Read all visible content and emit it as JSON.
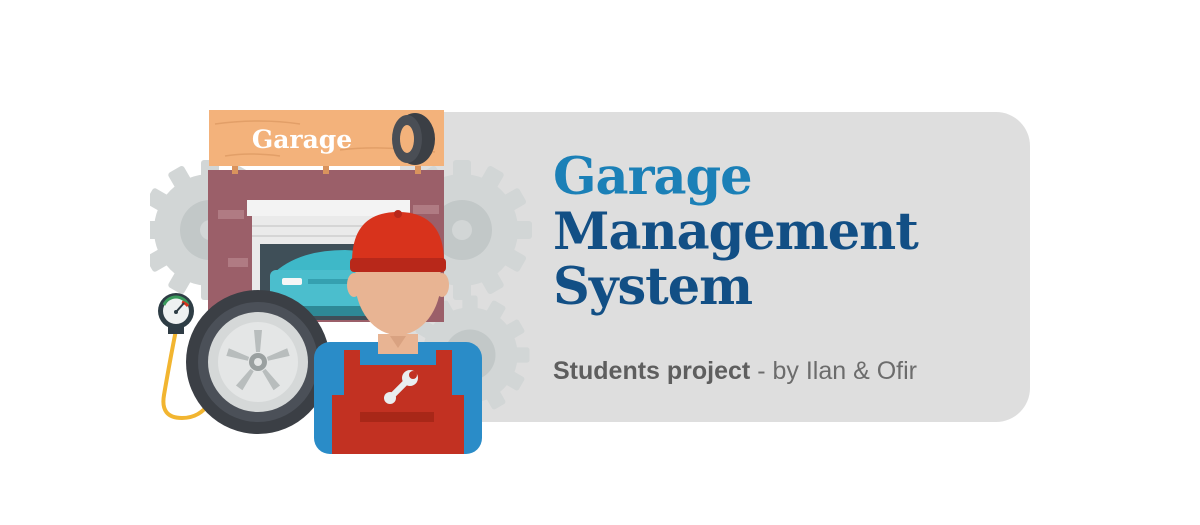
{
  "title": {
    "line1": "Garage",
    "line2": "Management",
    "line3": "System"
  },
  "subtitle": {
    "bold": "Students project",
    "rest": " - by Ilan & Ofir"
  },
  "sign": {
    "label": "Garage"
  },
  "colors": {
    "title_light_blue": "#1b80b7",
    "title_dark_blue": "#124f85",
    "banner_bg": "#dedede",
    "sign_orange": "#f3b27b",
    "wall_brick": "#9b5f69",
    "cap_red": "#d8331c",
    "overall_red": "#c23122",
    "shirt_blue": "#2a8cc8"
  },
  "icons": [
    "gear-icon",
    "tire-icon",
    "pressure-gauge-icon",
    "wrench-icon",
    "car-icon"
  ]
}
